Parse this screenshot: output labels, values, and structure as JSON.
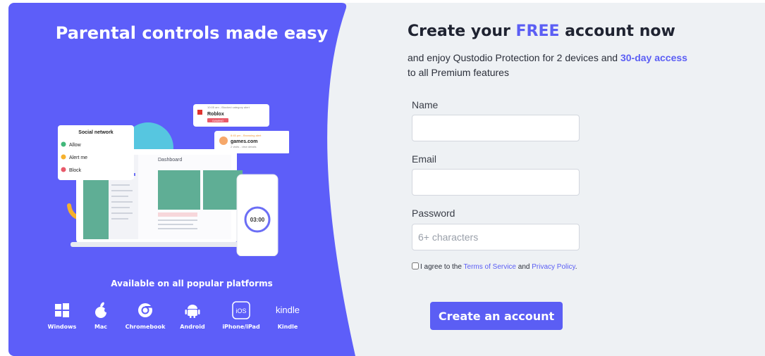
{
  "hero": {
    "title": "Parental controls made easy"
  },
  "illustration": {
    "social_card": {
      "title": "Social network",
      "options": [
        "Allow",
        "Alert me",
        "Block"
      ]
    },
    "alert_roblox": {
      "caption": "10:05 am - Blocked category alert",
      "name": "Roblox",
      "badge": "GAMING"
    },
    "alert_games": {
      "caption": "8:45 pm - Browsing alert",
      "name": "games.com",
      "detail": "2 visits - view details"
    },
    "dashboard": {
      "title": "Dashboard",
      "timer_value": "03:00"
    }
  },
  "platforms": {
    "title": "Available on all popular platforms",
    "items": [
      {
        "label": "Windows",
        "icon": "windows-icon"
      },
      {
        "label": "Mac",
        "icon": "apple-icon"
      },
      {
        "label": "Chromebook",
        "icon": "chrome-icon"
      },
      {
        "label": "Android",
        "icon": "android-icon"
      },
      {
        "label": "iPhone/iPad",
        "icon": "ios-icon",
        "icon_text": "iOS"
      },
      {
        "label": "Kindle",
        "icon": "kindle-icon",
        "icon_text": "kindle"
      }
    ]
  },
  "form": {
    "title_prefix": "Create your ",
    "title_accent": "FREE",
    "title_suffix": " account now",
    "subtitle_part1": "and enjoy Qustodio Protection for 2 devices and ",
    "subtitle_accent": "30-day access",
    "subtitle_part2": " to all Premium features",
    "name_label": "Name",
    "name_value": "",
    "email_label": "Email",
    "email_value": "",
    "password_label": "Password",
    "password_placeholder": "6+ characters",
    "terms_prefix": "I agree to the ",
    "terms_link": "Terms of Service",
    "terms_and": " and ",
    "privacy_link": "Privacy Policy",
    "terms_end": ".",
    "submit_label": "Create an account"
  },
  "colors": {
    "brand_purple": "#5b5ef4",
    "right_bg": "#eef1f4",
    "dashboard_green": "#5fae95"
  }
}
